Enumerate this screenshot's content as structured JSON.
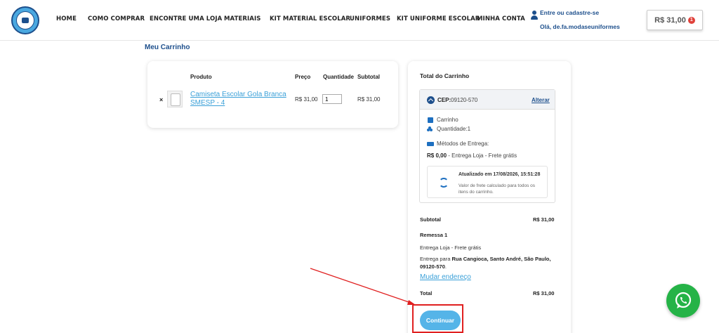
{
  "header": {
    "nav": [
      "HOME",
      "COMO COMPRAR",
      "ENCONTRE UMA LOJA",
      "MATERIAIS",
      "KIT MATERIAL ESCOLAR",
      "UNIFORMES",
      "KIT UNIFORME ESCOLAR",
      "MINHA CONTA"
    ],
    "account_link": "Entre ou cadastre-se",
    "account_hello": "Olá, de.fa.modaseuniformes",
    "cart_total": "R$ 31,00",
    "cart_count": "1"
  },
  "page_title": "Meu Carrinho",
  "cart_table": {
    "headers": {
      "product": "Produto",
      "price": "Preço",
      "quantity": "Quantidade",
      "subtotal": "Subtotal"
    },
    "items": [
      {
        "name": "Camiseta Escolar Gola Branca SMESP - 4",
        "price": "R$ 31,00",
        "quantity": "1",
        "subtotal": "R$ 31,00",
        "remove": "×"
      }
    ]
  },
  "totals": {
    "title": "Total do Carrinho",
    "cep_label": "CEP:",
    "cep_value": "09120-570",
    "change_cep": "Alterar",
    "cart_label": "Carrinho",
    "quantity_label": "Quantidade:",
    "quantity_value": "1",
    "methods_label": "Métodos de Entrega:",
    "method_price": "R$ 0,00",
    "method_desc": " - Entrega Loja - Frete grátis",
    "updated": "Atualizado em 17/08/2026, 15:51:28",
    "updated_note": "Valor de frete calculado para todos os itens do carrinho.",
    "subtotal_label": "Subtotal",
    "subtotal_value": "R$ 31,00",
    "shipment_label": "Remessa 1",
    "shipment_method": "Entrega Loja - Frete grátis",
    "delivery_prefix": "Entrega para ",
    "delivery_address": "Rua Cangioca, Santo André, São Paulo, 09120-570",
    "delivery_suffix": ".",
    "change_address": "Mudar endereço",
    "total_label": "Total",
    "total_value": "R$ 31,00",
    "continue": "Continuar"
  },
  "colors": {
    "brand": "#1d4f8c",
    "link": "#3aa0d8",
    "button": "#55b4e8",
    "annotation": "#e02020",
    "whatsapp": "#25b347"
  }
}
